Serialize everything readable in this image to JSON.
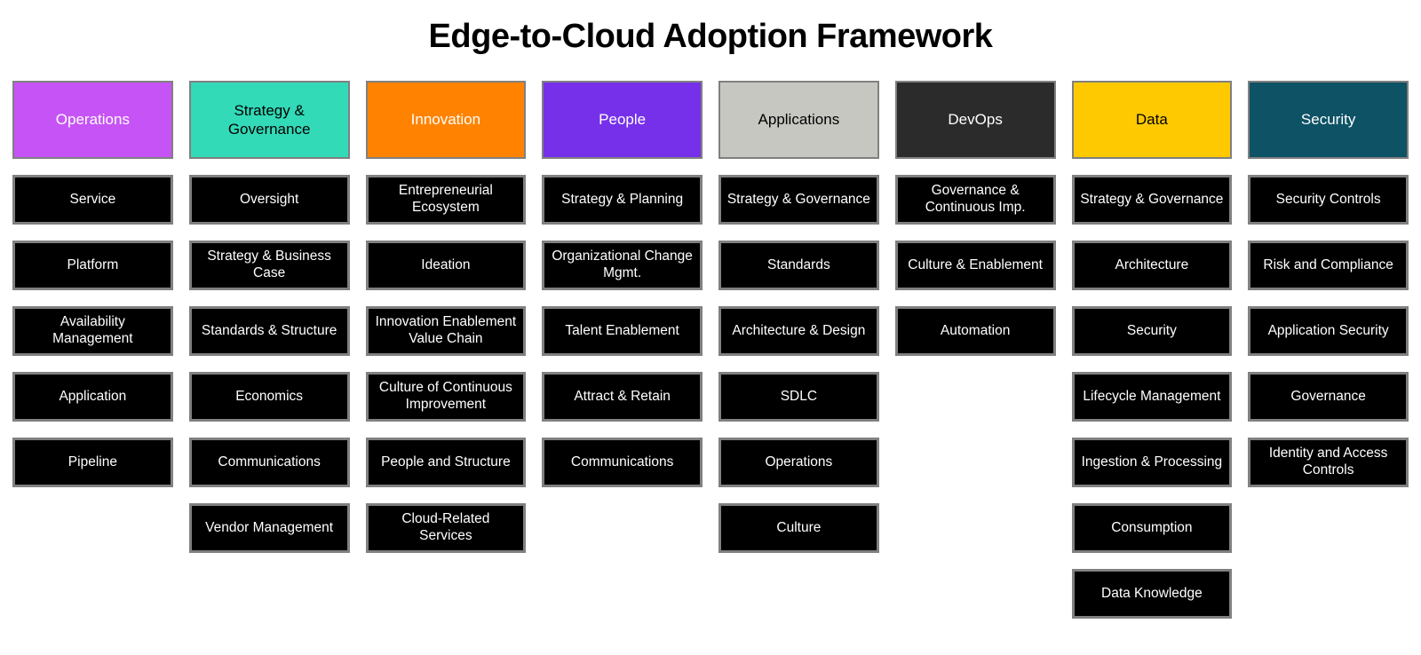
{
  "title": "Edge-to-Cloud Adoption Framework",
  "columns": [
    {
      "name": "operations",
      "label": "Operations",
      "header_bg": "#c653f5",
      "header_fg": "#ffffff",
      "items": [
        "Service",
        "Platform",
        "Availability Management",
        "Application",
        "Pipeline"
      ]
    },
    {
      "name": "strategy-governance",
      "label": "Strategy & Governance",
      "header_bg": "#32dab8",
      "header_fg": "#000000",
      "items": [
        "Oversight",
        "Strategy & Business Case",
        "Standards & Structure",
        "Economics",
        "Communications",
        "Vendor Management"
      ]
    },
    {
      "name": "innovation",
      "label": "Innovation",
      "header_bg": "#ff8300",
      "header_fg": "#ffffff",
      "items": [
        "Entrepreneurial Ecosystem",
        "Ideation",
        "Innovation Enablement Value Chain",
        "Culture of Continuous Improvement",
        "People and Structure",
        "Cloud-Related Services"
      ]
    },
    {
      "name": "people",
      "label": "People",
      "header_bg": "#7630ea",
      "header_fg": "#ffffff",
      "items": [
        "Strategy & Planning",
        "Organizational Change Mgmt.",
        "Talent Enablement",
        "Attract & Retain",
        "Communications"
      ]
    },
    {
      "name": "applications",
      "label": "Applications",
      "header_bg": "#c7c7c2",
      "header_fg": "#000000",
      "items": [
        "Strategy & Governance",
        "Standards",
        "Architecture & Design",
        "SDLC",
        "Operations",
        "Culture"
      ]
    },
    {
      "name": "devops",
      "label": "DevOps",
      "header_bg": "#2b2b2b",
      "header_fg": "#ffffff",
      "items": [
        "Governance & Continuous Imp.",
        "Culture & Enablement",
        "Automation"
      ]
    },
    {
      "name": "data",
      "label": "Data",
      "header_bg": "#fec901",
      "header_fg": "#000000",
      "items": [
        "Strategy & Governance",
        "Architecture",
        "Security",
        "Lifecycle Management",
        "Ingestion & Processing",
        "Consumption",
        "Data Knowledge"
      ]
    },
    {
      "name": "security",
      "label": "Security",
      "header_bg": "#0d5265",
      "header_fg": "#ffffff",
      "items": [
        "Security Controls",
        "Risk and Compliance",
        "Application Security",
        "Governance",
        "Identity and Access Controls"
      ]
    }
  ]
}
